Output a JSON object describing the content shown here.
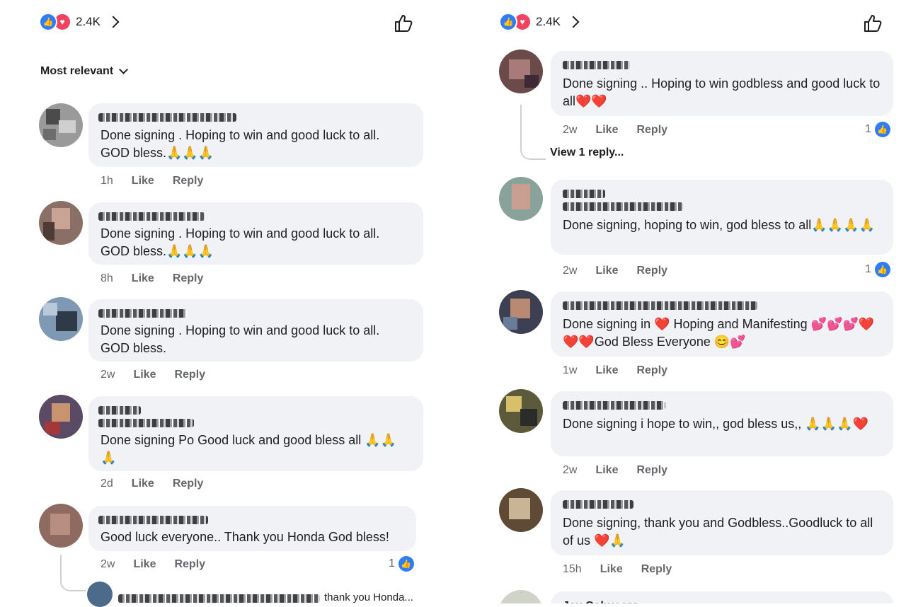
{
  "left": {
    "reactions_count": "2.4K",
    "sort_label": "Most relevant",
    "comments": [
      {
        "text": "Done signing . Hoping to win and good luck to all. GOD bless.🙏🙏🙏",
        "time": "1h",
        "like": "Like",
        "reply": "Reply"
      },
      {
        "text": "Done signing . Hoping to win and good luck to all. GOD bless.🙏🙏🙏",
        "time": "8h",
        "like": "Like",
        "reply": "Reply"
      },
      {
        "text": "Done signing . Hoping to win and good luck to all. GOD bless.",
        "time": "2w",
        "like": "Like",
        "reply": "Reply"
      },
      {
        "text": "Done signing Po Good luck and good bless all 🙏🙏🙏",
        "time": "2d",
        "like": "Like",
        "reply": "Reply"
      },
      {
        "text": "Good luck everyone.. Thank you Honda God bless!",
        "time": "2w",
        "like": "Like",
        "reply": "Reply",
        "likes": "1"
      }
    ],
    "reply_preview": "thank you Honda..."
  },
  "right": {
    "reactions_count": "2.4K",
    "view_replies": "View 1 reply...",
    "comments": [
      {
        "text": "Done signing .. Hoping to win godbless and good luck to all❤️❤️",
        "time": "2w",
        "like": "Like",
        "reply": "Reply",
        "likes": "1"
      },
      {
        "text": "Done signing, hoping to win, god bless to all🙏🙏🙏🙏",
        "time": "2w",
        "like": "Like",
        "reply": "Reply",
        "likes": "1"
      },
      {
        "text": "Done signing in ❤️ Hoping and Manifesting 💕💕💕❤️❤️❤️God Bless Everyone 😊💕",
        "time": "1w",
        "like": "Like",
        "reply": "Reply"
      },
      {
        "text": "Done signing i hope to win,, god bless us,, 🙏🙏🙏❤️",
        "time": "2w",
        "like": "Like",
        "reply": "Reply"
      },
      {
        "text": "Done signing, thank you and Godbless..Goodluck to all of us ❤️🙏",
        "time": "15h",
        "like": "Like",
        "reply": "Reply"
      }
    ],
    "partial_name": "Joy Cobucoro"
  },
  "colors": {
    "like_blue": "#2e7cf6",
    "love_red": "#f3425f",
    "bubble_bg": "#f0f2f5",
    "meta_gray": "#65676b"
  },
  "icons": {
    "like": "thumbs-up-icon",
    "love": "heart-icon",
    "chevron": "chevron-right-icon",
    "sort_chevron": "chevron-down-icon"
  }
}
